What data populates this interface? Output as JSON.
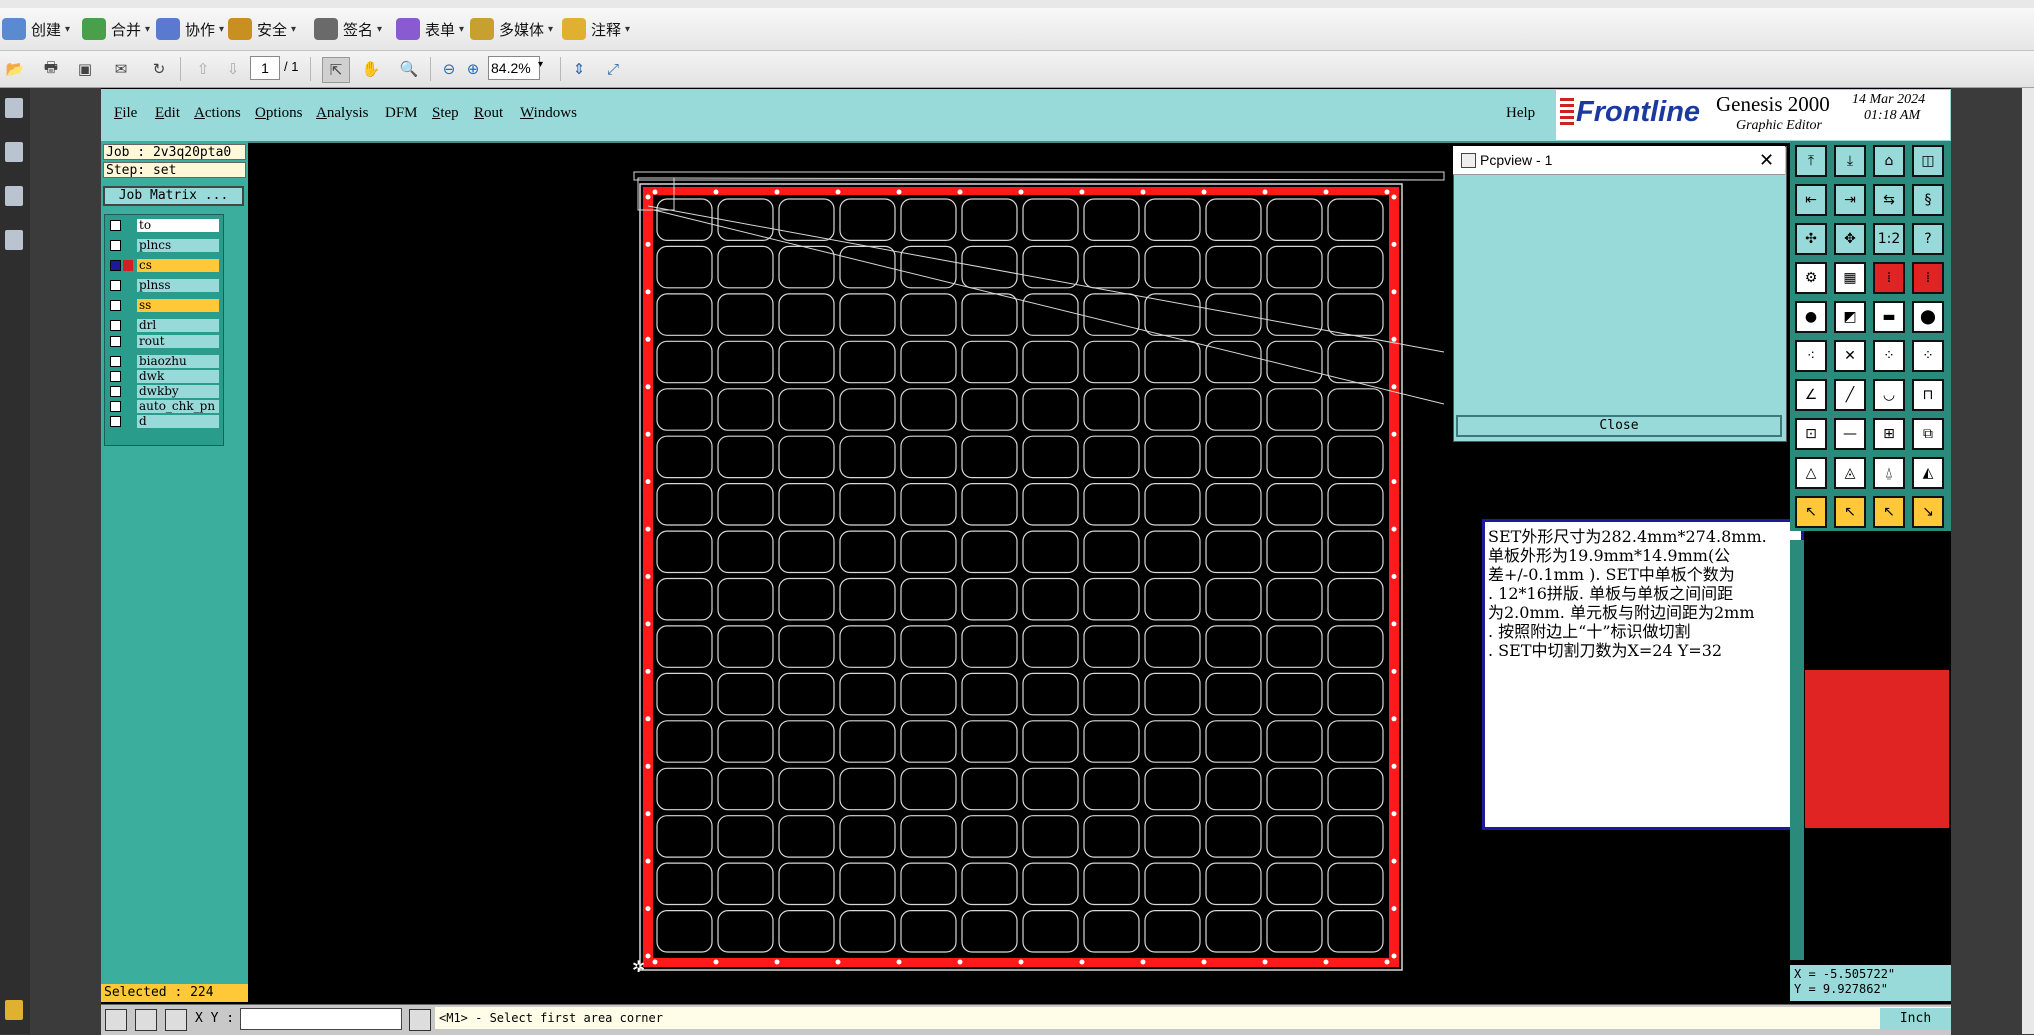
{
  "acrobat": {
    "toolbar": [
      {
        "label": "创建",
        "icon": "create-icon"
      },
      {
        "label": "合并",
        "icon": "merge-icon"
      },
      {
        "label": "协作",
        "icon": "collaborate-icon"
      },
      {
        "label": "安全",
        "icon": "lock-icon"
      },
      {
        "label": "签名",
        "icon": "pen-icon"
      },
      {
        "label": "表单",
        "icon": "form-icon"
      },
      {
        "label": "多媒体",
        "icon": "multimedia-icon"
      },
      {
        "label": "注释",
        "icon": "comment-icon"
      }
    ],
    "page_current": "1",
    "page_total": "/ 1",
    "zoom": "84.2%"
  },
  "genesis": {
    "menu": [
      {
        "label": "File",
        "u": "F",
        "rest": "ile"
      },
      {
        "label": "Edit",
        "u": "E",
        "rest": "dit"
      },
      {
        "label": "Actions",
        "u": "A",
        "rest": "ctions"
      },
      {
        "label": "Options",
        "u": "O",
        "rest": "ptions"
      },
      {
        "label": "Analysis",
        "u": "A",
        "rest": "nalysis"
      },
      {
        "label": "DFM",
        "u": "",
        "rest": "DFM"
      },
      {
        "label": "Step",
        "u": "S",
        "rest": "tep"
      },
      {
        "label": "Rout",
        "u": "R",
        "rest": "out"
      },
      {
        "label": "Windows",
        "u": "W",
        "rest": "indows"
      }
    ],
    "help": "Help",
    "brand": "Frontline",
    "product": "Genesis 2000",
    "subtitle": "Graphic Editor",
    "date": "14 Mar 2024",
    "time": "01:18 AM",
    "job": "Job : 2v3q20pta0",
    "step": "Step: set",
    "job_matrix": "Job Matrix ...",
    "layers": [
      {
        "name": "to",
        "state": "white"
      },
      {
        "name": "plncs",
        "state": "normal"
      },
      {
        "name": "cs",
        "state": "work"
      },
      {
        "name": "plnss",
        "state": "normal"
      },
      {
        "name": "ss",
        "state": "yellow"
      },
      {
        "name": "drl",
        "state": "normal"
      },
      {
        "name": "rout",
        "state": "normal"
      },
      {
        "name": "biaozhu",
        "state": "normal"
      },
      {
        "name": "dwk",
        "state": "normal"
      },
      {
        "name": "dwkby",
        "state": "normal"
      },
      {
        "name": "auto_chk_pn",
        "state": "normal"
      },
      {
        "name": "d",
        "state": "normal"
      }
    ],
    "selected": "Selected : 224",
    "xy_label": "X Y :",
    "prompt": "<M1> - Select first area corner",
    "coord_x": "X = -5.505722\"",
    "coord_y": "Y = 9.927862\"",
    "unit": "Inch"
  },
  "pcpview": {
    "title": "Pcpview - 1",
    "close": "Close"
  },
  "note": {
    "lines": [
      "SET外形尺寸为282.4mm*274.8mm.",
      "单板外形为19.9mm*14.9mm(公",
      "差+/-0.1mm ). SET中单板个数为",
      ". 12*16拼版. 单板与单板之间间距",
      "为2.0mm. 单元板与附边间距为2mm",
      ". 按照附边上“十”标识做切割",
      ". SET中切割刀数为X=24    Y=32"
    ]
  },
  "board": {
    "cols": 12,
    "rows": 16
  },
  "colors": {
    "teal": "#98dada",
    "pad_red": "#ff1a1a",
    "outline": "#d8d8d8"
  }
}
